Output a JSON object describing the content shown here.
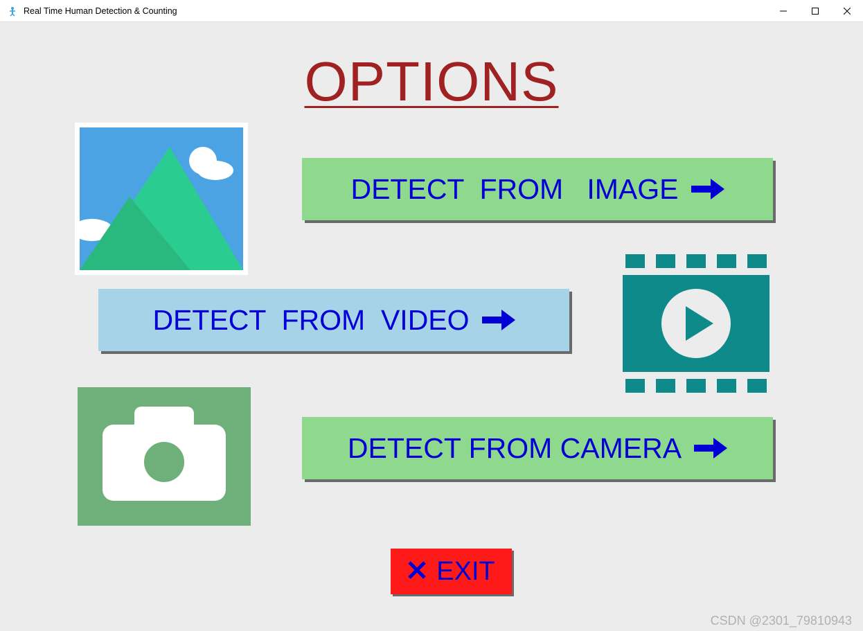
{
  "window": {
    "title": "Real Time Human Detection & Counting"
  },
  "heading": "OPTIONS",
  "buttons": {
    "image": "DETECT  FROM   IMAGE",
    "video": "DETECT  FROM  VIDEO",
    "camera": "DETECT FROM CAMERA",
    "exit": "EXIT"
  },
  "watermark": "CSDN @2301_79810943",
  "colors": {
    "heading": "#a02121",
    "button_text": "#0000d6",
    "green_btn": "#8ed98e",
    "blue_btn": "#a7d3e8",
    "exit_btn": "#ff1a1a",
    "content_bg": "#ececec"
  }
}
